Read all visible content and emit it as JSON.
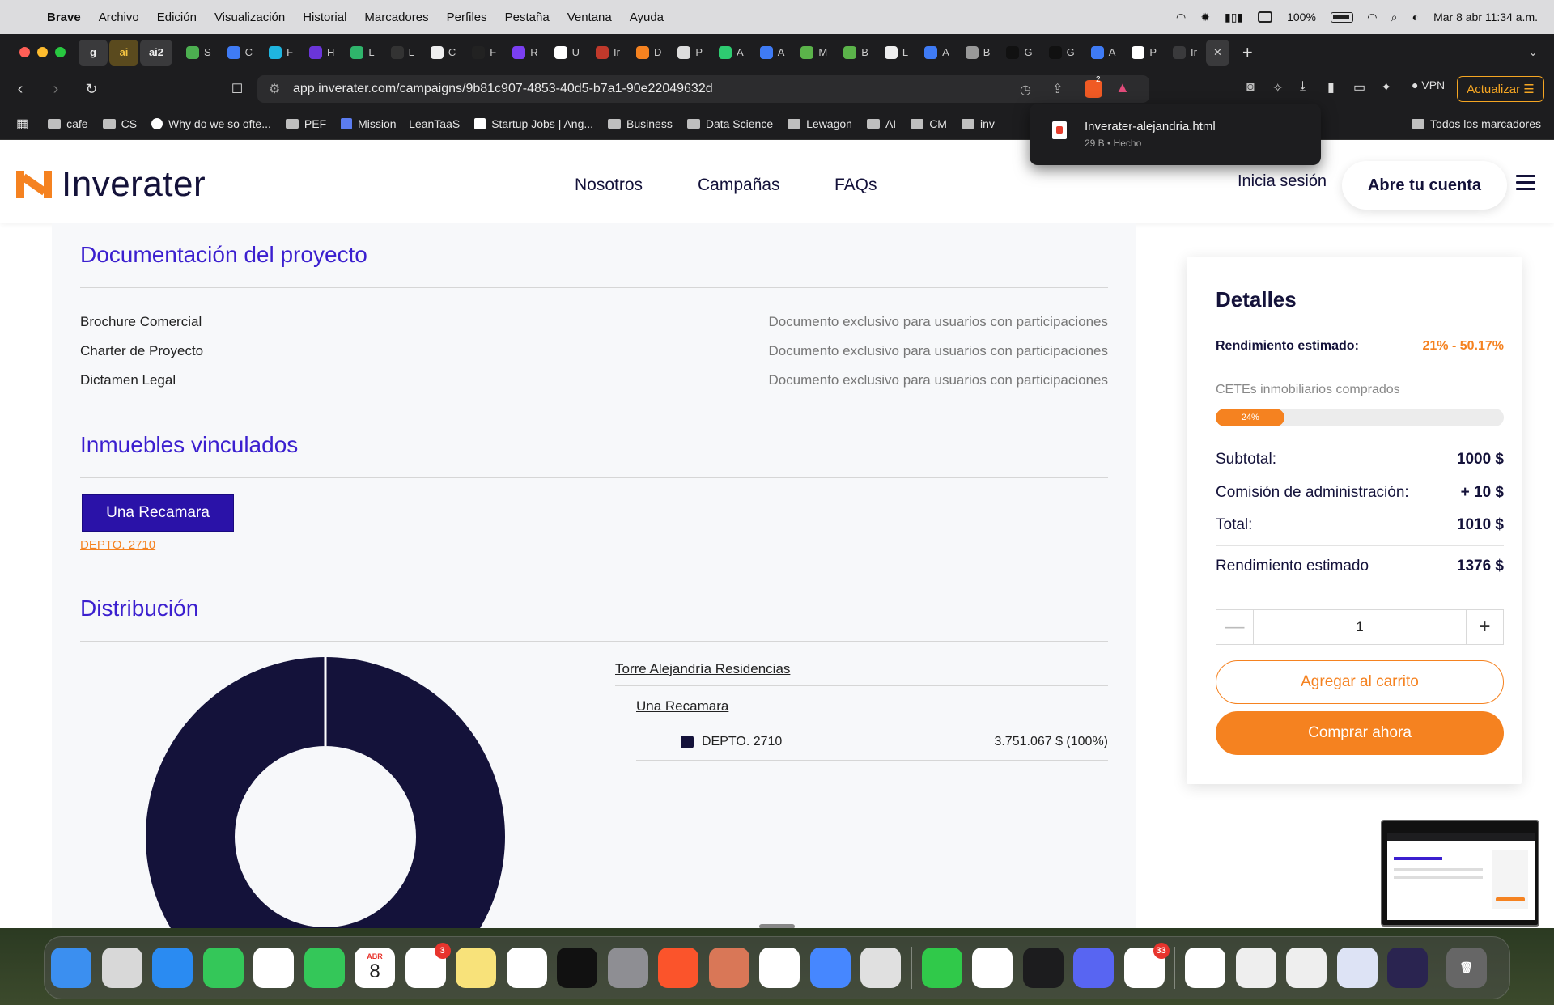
{
  "menubar": {
    "app": "Brave",
    "items": [
      "Archivo",
      "Edición",
      "Visualización",
      "Historial",
      "Marcadores",
      "Perfiles",
      "Pestaña",
      "Ventana",
      "Ayuda"
    ],
    "battery": "100%",
    "datetime": "Mar 8 abr 11:34 a.m."
  },
  "tabs": {
    "pinned": [
      "g",
      "ai",
      "ai2"
    ],
    "items": [
      {
        "label": "S",
        "color": "#4caf50"
      },
      {
        "label": "C",
        "color": "#3f7bf5"
      },
      {
        "label": "F",
        "color": "#1fb5e0"
      },
      {
        "label": "H",
        "color": "#6a35d9"
      },
      {
        "label": "L",
        "color": "#2fb46b"
      },
      {
        "label": "L",
        "color": "#333333"
      },
      {
        "label": "C",
        "color": "#eeeeee"
      },
      {
        "label": "F",
        "color": "#222222"
      },
      {
        "label": "R",
        "color": "#7b3ff2"
      },
      {
        "label": "U",
        "color": "#ffffff"
      },
      {
        "label": "Ir",
        "color": "#c0392b"
      },
      {
        "label": "D",
        "color": "#f58220"
      },
      {
        "label": "P",
        "color": "#dddddd"
      },
      {
        "label": "A",
        "color": "#2ecc71"
      },
      {
        "label": "A",
        "color": "#3f7bf5"
      },
      {
        "label": "M",
        "color": "#5bb34a"
      },
      {
        "label": "B",
        "color": "#5bb34a"
      },
      {
        "label": "L",
        "color": "#eeeeee"
      },
      {
        "label": "A",
        "color": "#3f7bf5"
      },
      {
        "label": "B",
        "color": "#999999"
      },
      {
        "label": "G",
        "color": "#111111"
      },
      {
        "label": "G",
        "color": "#111111"
      },
      {
        "label": "A",
        "color": "#3f7bf5"
      },
      {
        "label": "P",
        "color": "#ffffff"
      },
      {
        "label": "Ir",
        "color": "#3a3a3c"
      }
    ]
  },
  "address": {
    "url": "app.inverater.com/campaigns/9b81c907-4853-40d5-b7a1-90e22049632d",
    "shield_count": "2",
    "vpn": "VPN",
    "update": "Actualizar"
  },
  "bookmarks": {
    "items": [
      "cafe",
      "CS",
      "Why do we so ofte...",
      "PEF",
      "Mission – LeanTaaS",
      "Startup Jobs | Ang...",
      "Business",
      "Data Science",
      "Lewagon",
      "AI",
      "CM",
      "inv"
    ],
    "all": "Todos los marcadores"
  },
  "download": {
    "filename": "Inverater-alejandria.html",
    "status": "29 B • Hecho"
  },
  "header": {
    "logo": "Inverater",
    "nav": [
      "Nosotros",
      "Campañas",
      "FAQs"
    ],
    "login": "Inicia sesión",
    "open_account": "Abre tu cuenta"
  },
  "documentation": {
    "title": "Documentación del proyecto",
    "docs": [
      {
        "name": "Brochure Comercial",
        "note": "Documento exclusivo para usuarios con participaciones"
      },
      {
        "name": "Charter de Proyecto",
        "note": "Documento exclusivo para usuarios con participaciones"
      },
      {
        "name": "Dictamen Legal",
        "note": "Documento exclusivo para usuarios con participaciones"
      }
    ]
  },
  "properties": {
    "title": "Inmuebles vinculados",
    "tag": "Una Recamara",
    "link": "DEPTO. 2710"
  },
  "distribution": {
    "title": "Distribución",
    "tower": "Torre Alejandría Residencias",
    "type": "Una Recamara",
    "unit": "DEPTO. 2710",
    "amount": "3.751.067 $ (100%)",
    "share": 1.0,
    "color": "#14123a"
  },
  "details": {
    "title": "Detalles",
    "est_return_label": "Rendimiento estimado:",
    "est_return_value": "21% - 50.17%",
    "cetes_label": "CETEs inmobiliarios comprados",
    "progress_label": "24%",
    "progress": 0.24,
    "subtotal_label": "Subtotal:",
    "subtotal": "1000 $",
    "fee_label": "Comisión de administración:",
    "fee": "+ 10 $",
    "total_label": "Total:",
    "total": "1010 $",
    "return_label": "Rendimiento estimado",
    "return_value": "1376 $",
    "quantity": "1",
    "minus": "—",
    "plus": "+",
    "add_to_cart": "Agregar al carrito",
    "buy_now": "Comprar ahora"
  },
  "dock": {
    "apps": [
      {
        "name": "finder",
        "color": "#3b8ff0"
      },
      {
        "name": "launchpad",
        "color": "#d8d8d8"
      },
      {
        "name": "safari",
        "color": "#2a8bf2"
      },
      {
        "name": "messages",
        "color": "#34c759"
      },
      {
        "name": "photos",
        "color": "#ffffff"
      },
      {
        "name": "facetime",
        "color": "#34c759"
      },
      {
        "name": "calendar",
        "color": "#ffffff"
      },
      {
        "name": "reminders",
        "color": "#ffffff"
      },
      {
        "name": "notes",
        "color": "#f8e27a"
      },
      {
        "name": "freeform",
        "color": "#ffffff"
      },
      {
        "name": "stocks",
        "color": "#111111"
      },
      {
        "name": "system-settings",
        "color": "#8e8e93"
      },
      {
        "name": "brave",
        "color": "#fb542b"
      },
      {
        "name": "claude",
        "color": "#d97757"
      },
      {
        "name": "chatgpt",
        "color": "#ffffff"
      },
      {
        "name": "nordvpn",
        "color": "#4687ff"
      },
      {
        "name": "iphone-mirroring",
        "color": "#e0e0e0"
      }
    ],
    "apps2": [
      {
        "name": "numbers",
        "color": "#30c94a"
      },
      {
        "name": "chrome",
        "color": "#ffffff"
      },
      {
        "name": "voice-memos",
        "color": "#1c1c1e"
      },
      {
        "name": "discord",
        "color": "#5865f2"
      },
      {
        "name": "slack",
        "color": "#ffffff"
      }
    ],
    "calendar_month": "ABR",
    "calendar_day": "8",
    "reminders_badge": "3",
    "slack_badge": "33"
  }
}
